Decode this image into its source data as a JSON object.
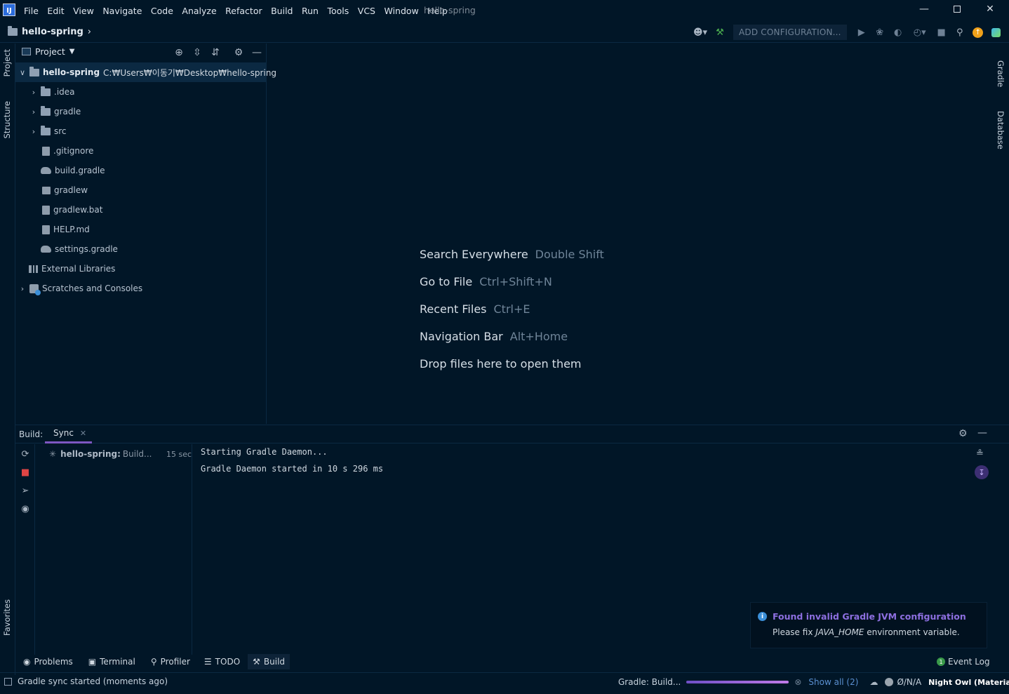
{
  "window": {
    "logo": "IJ",
    "title": "hello-spring",
    "menu": [
      "File",
      "Edit",
      "View",
      "Navigate",
      "Code",
      "Analyze",
      "Refactor",
      "Build",
      "Run",
      "Tools",
      "VCS",
      "Window",
      "Help"
    ]
  },
  "navbar": {
    "project": "hello-spring",
    "add_configuration": "ADD CONFIGURATION..."
  },
  "left_strip": {
    "project_tab": "Project",
    "structure_tab": "Structure",
    "favorites_tab": "Favorites"
  },
  "right_strip": {
    "gradle_tab": "Gradle",
    "database_tab": "Database"
  },
  "project_panel": {
    "title": "Project",
    "root": {
      "name": "hello-spring",
      "path": "C:₩Users₩이동기₩Desktop₩hello-spring"
    },
    "items": [
      {
        "label": ".idea",
        "kind": "folder"
      },
      {
        "label": "gradle",
        "kind": "folder"
      },
      {
        "label": "src",
        "kind": "folder"
      },
      {
        "label": ".gitignore",
        "kind": "file"
      },
      {
        "label": "build.gradle",
        "kind": "gradle"
      },
      {
        "label": "gradlew",
        "kind": "file"
      },
      {
        "label": "gradlew.bat",
        "kind": "file"
      },
      {
        "label": "HELP.md",
        "kind": "file"
      },
      {
        "label": "settings.gradle",
        "kind": "gradle"
      }
    ],
    "external_libraries": "External Libraries",
    "scratches": "Scratches and Consoles"
  },
  "editor_hints": [
    {
      "action": "Search Everywhere",
      "shortcut": "Double Shift"
    },
    {
      "action": "Go to File",
      "shortcut": "Ctrl+Shift+N"
    },
    {
      "action": "Recent Files",
      "shortcut": "Ctrl+E"
    },
    {
      "action": "Navigation Bar",
      "shortcut": "Alt+Home"
    },
    {
      "action": "Drop files here to open them",
      "shortcut": ""
    }
  ],
  "build": {
    "label": "Build:",
    "tab": "Sync",
    "item_name": "hello-spring:",
    "item_status": "Build...",
    "item_time": "15 sec",
    "console": [
      "Starting Gradle Daemon...",
      "Gradle Daemon started in 10 s 296 ms"
    ]
  },
  "notification": {
    "title": "Found invalid Gradle JVM configuration",
    "body_prefix": "Please fix ",
    "body_var": "JAVA_HOME",
    "body_suffix": " environment variable."
  },
  "tool_buttons": [
    "Problems",
    "Terminal",
    "Profiler",
    "TODO",
    "Build"
  ],
  "event_log": {
    "label": "Event Log",
    "count": "1"
  },
  "status": {
    "message": "Gradle sync started (moments ago)",
    "task": "Gradle: Build...",
    "progress": 1.0,
    "show_all": "Show all (2)",
    "na": "Ø/N/A",
    "theme": "Night Owl (Material)"
  },
  "colors": {
    "background": "#011627",
    "accent": "#7e57c2",
    "selection": "#0b2942"
  }
}
